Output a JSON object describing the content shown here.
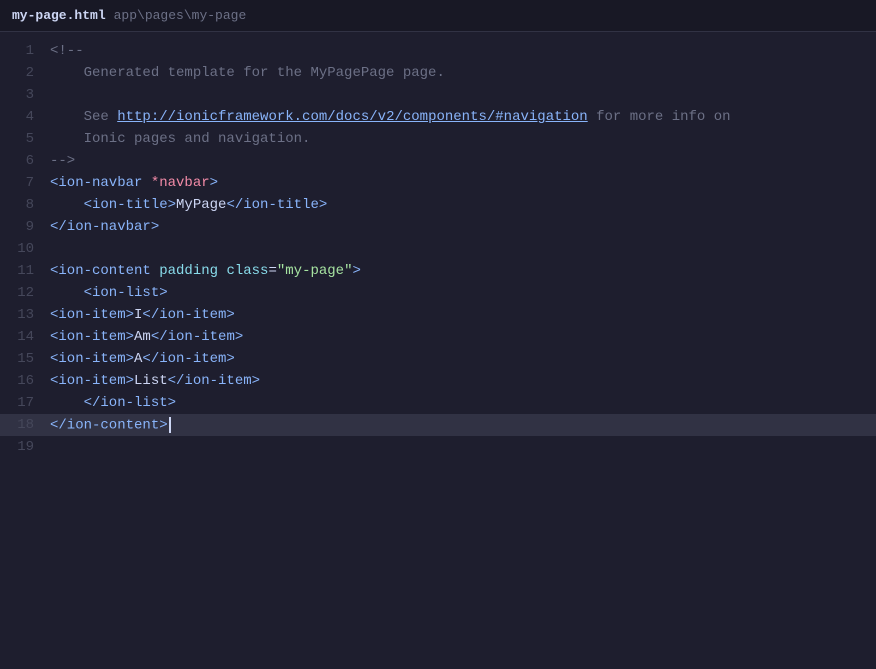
{
  "titleBar": {
    "filename": "my-page.html",
    "path": "app\\pages\\my-page"
  },
  "lines": [
    {
      "num": 1,
      "tokens": [
        {
          "t": "comment",
          "v": "<!--"
        }
      ]
    },
    {
      "num": 2,
      "tokens": [
        {
          "t": "comment",
          "v": "    Generated template for the MyPagePage page."
        }
      ]
    },
    {
      "num": 3,
      "tokens": []
    },
    {
      "num": 4,
      "tokens": [
        {
          "t": "comment",
          "v": "    See "
        },
        {
          "t": "link",
          "v": "http://ionicframework.com/docs/v2/components/#navigation"
        },
        {
          "t": "comment",
          "v": " for more info on"
        }
      ]
    },
    {
      "num": 5,
      "tokens": [
        {
          "t": "comment",
          "v": "    Ionic pages and navigation."
        }
      ]
    },
    {
      "num": 6,
      "tokens": [
        {
          "t": "comment",
          "v": "-->"
        }
      ]
    },
    {
      "num": 7,
      "tokens": [
        {
          "t": "tag",
          "v": "<ion-navbar"
        },
        {
          "t": "special-attr",
          "v": " *navbar"
        },
        {
          "t": "tag",
          "v": ">"
        }
      ]
    },
    {
      "num": 8,
      "tokens": [
        {
          "t": "tag",
          "v": "    <ion-title>"
        },
        {
          "t": "text-content",
          "v": "MyPage"
        },
        {
          "t": "tag",
          "v": "</ion-title>"
        }
      ]
    },
    {
      "num": 9,
      "tokens": [
        {
          "t": "tag",
          "v": "</ion-navbar>"
        }
      ]
    },
    {
      "num": 10,
      "tokens": []
    },
    {
      "num": 11,
      "tokens": [
        {
          "t": "tag",
          "v": "<ion-content"
        },
        {
          "t": "attr-name",
          "v": " padding"
        },
        {
          "t": "attr-name",
          "v": " class"
        },
        {
          "t": "punctuation",
          "v": "="
        },
        {
          "t": "string",
          "v": "\"my-page\""
        },
        {
          "t": "tag",
          "v": ">"
        }
      ]
    },
    {
      "num": 12,
      "tokens": [
        {
          "t": "tag",
          "v": "    <ion-list>"
        }
      ]
    },
    {
      "num": 13,
      "tokens": [
        {
          "t": "tag",
          "v": "<ion-item>"
        },
        {
          "t": "text-content",
          "v": "I"
        },
        {
          "t": "tag",
          "v": "</ion-item>"
        }
      ]
    },
    {
      "num": 14,
      "tokens": [
        {
          "t": "tag",
          "v": "<ion-item>"
        },
        {
          "t": "text-content",
          "v": "Am"
        },
        {
          "t": "tag",
          "v": "</ion-item>"
        }
      ]
    },
    {
      "num": 15,
      "tokens": [
        {
          "t": "tag",
          "v": "<ion-item>"
        },
        {
          "t": "text-content",
          "v": "A"
        },
        {
          "t": "tag",
          "v": "</ion-item>"
        }
      ]
    },
    {
      "num": 16,
      "tokens": [
        {
          "t": "tag",
          "v": "<ion-item>"
        },
        {
          "t": "text-content",
          "v": "List"
        },
        {
          "t": "tag",
          "v": "</ion-item>"
        }
      ]
    },
    {
      "num": 17,
      "tokens": [
        {
          "t": "tag",
          "v": "    </ion-list>"
        }
      ]
    },
    {
      "num": 18,
      "tokens": [
        {
          "t": "tag",
          "v": "</ion-content>"
        }
      ],
      "cursor": true
    },
    {
      "num": 19,
      "tokens": []
    }
  ]
}
